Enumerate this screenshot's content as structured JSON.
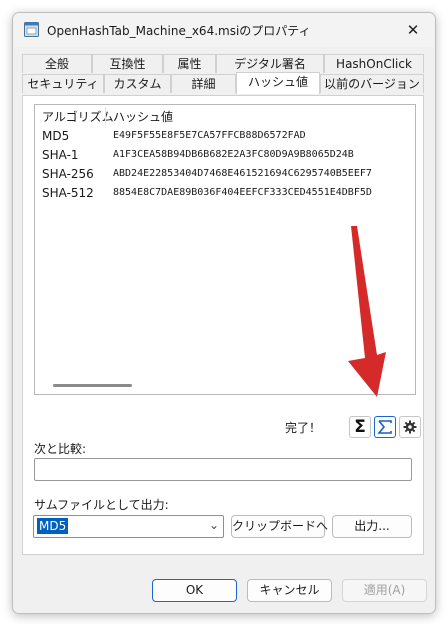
{
  "window": {
    "title": "OpenHashTab_Machine_x64.msiのプロパティ",
    "close_glyph": "✕"
  },
  "tabs_row1": [
    {
      "label": "全般"
    },
    {
      "label": "互換性"
    },
    {
      "label": "属性"
    },
    {
      "label": "デジタル署名"
    },
    {
      "label": "HashOnClick"
    }
  ],
  "tabs_row2": [
    {
      "label": "セキュリティ"
    },
    {
      "label": "カスタム"
    },
    {
      "label": "詳細"
    },
    {
      "label": "ハッシュ値"
    },
    {
      "label": "以前のバージョン"
    }
  ],
  "active_tab": "ハッシュ値",
  "list": {
    "headers": [
      "アルゴリズム",
      "ハッシュ値"
    ],
    "rows": [
      {
        "alg": "MD5",
        "hash": "E49F5F55E8F5E7CA57FFCB88D6572FAD"
      },
      {
        "alg": "SHA-1",
        "hash": "A1F3CEA58B94DB6B682E2A3FC80D9A9B8065D24B"
      },
      {
        "alg": "SHA-256",
        "hash": "ABD24E22853404D7468E461521694C6295740B5EEF7"
      },
      {
        "alg": "SHA-512",
        "hash": "8854E8C7DAE89B036F404EEFCF333CED4551E4DBF5D"
      }
    ]
  },
  "status": "完了！",
  "icons": {
    "sum": "sigma-icon",
    "hash": "hash-file-icon",
    "settings": "gear-icon"
  },
  "compare_label": "次と比較:",
  "compare_value": "",
  "sumfile_label": "サムファイルとして出力:",
  "format_select": "MD5",
  "clipboard_button": "クリップボードへ",
  "export_button": "出力...",
  "footer": {
    "ok": "OK",
    "cancel": "キャンセル",
    "apply": "適用(A)"
  },
  "colors": {
    "accent": "#0060c0",
    "arrow": "#d42a2a"
  }
}
